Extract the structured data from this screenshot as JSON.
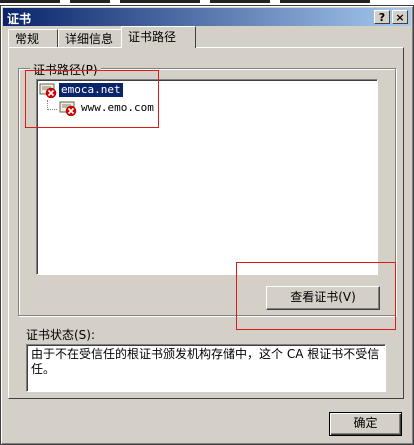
{
  "window": {
    "title": "证书",
    "help_glyph": "?",
    "close_glyph": "×"
  },
  "tabs": [
    {
      "label": "常规"
    },
    {
      "label": "详细信息"
    },
    {
      "label": "证书路径"
    }
  ],
  "path_group": {
    "label": "证书路径(P)",
    "tree": [
      {
        "label": "emoca.net",
        "selected": true
      },
      {
        "label": "www.emo.com",
        "selected": false
      }
    ]
  },
  "buttons": {
    "view_certificate": "查看证书(V)",
    "ok": "确定"
  },
  "status": {
    "label": "证书状态(S):",
    "text": "由于不在受信任的根证书颁发机构存储中，这个 CA 根证书不受信任。"
  },
  "colors": {
    "title_start": "#0a246a",
    "title_end": "#a6caf0",
    "dialog_bg": "#d4d0c8",
    "selection_bg": "#0a246a",
    "highlight_red": "#e01818",
    "error_icon_red": "#d80000"
  },
  "icons": {
    "cert_error": "certificate-error-icon"
  }
}
